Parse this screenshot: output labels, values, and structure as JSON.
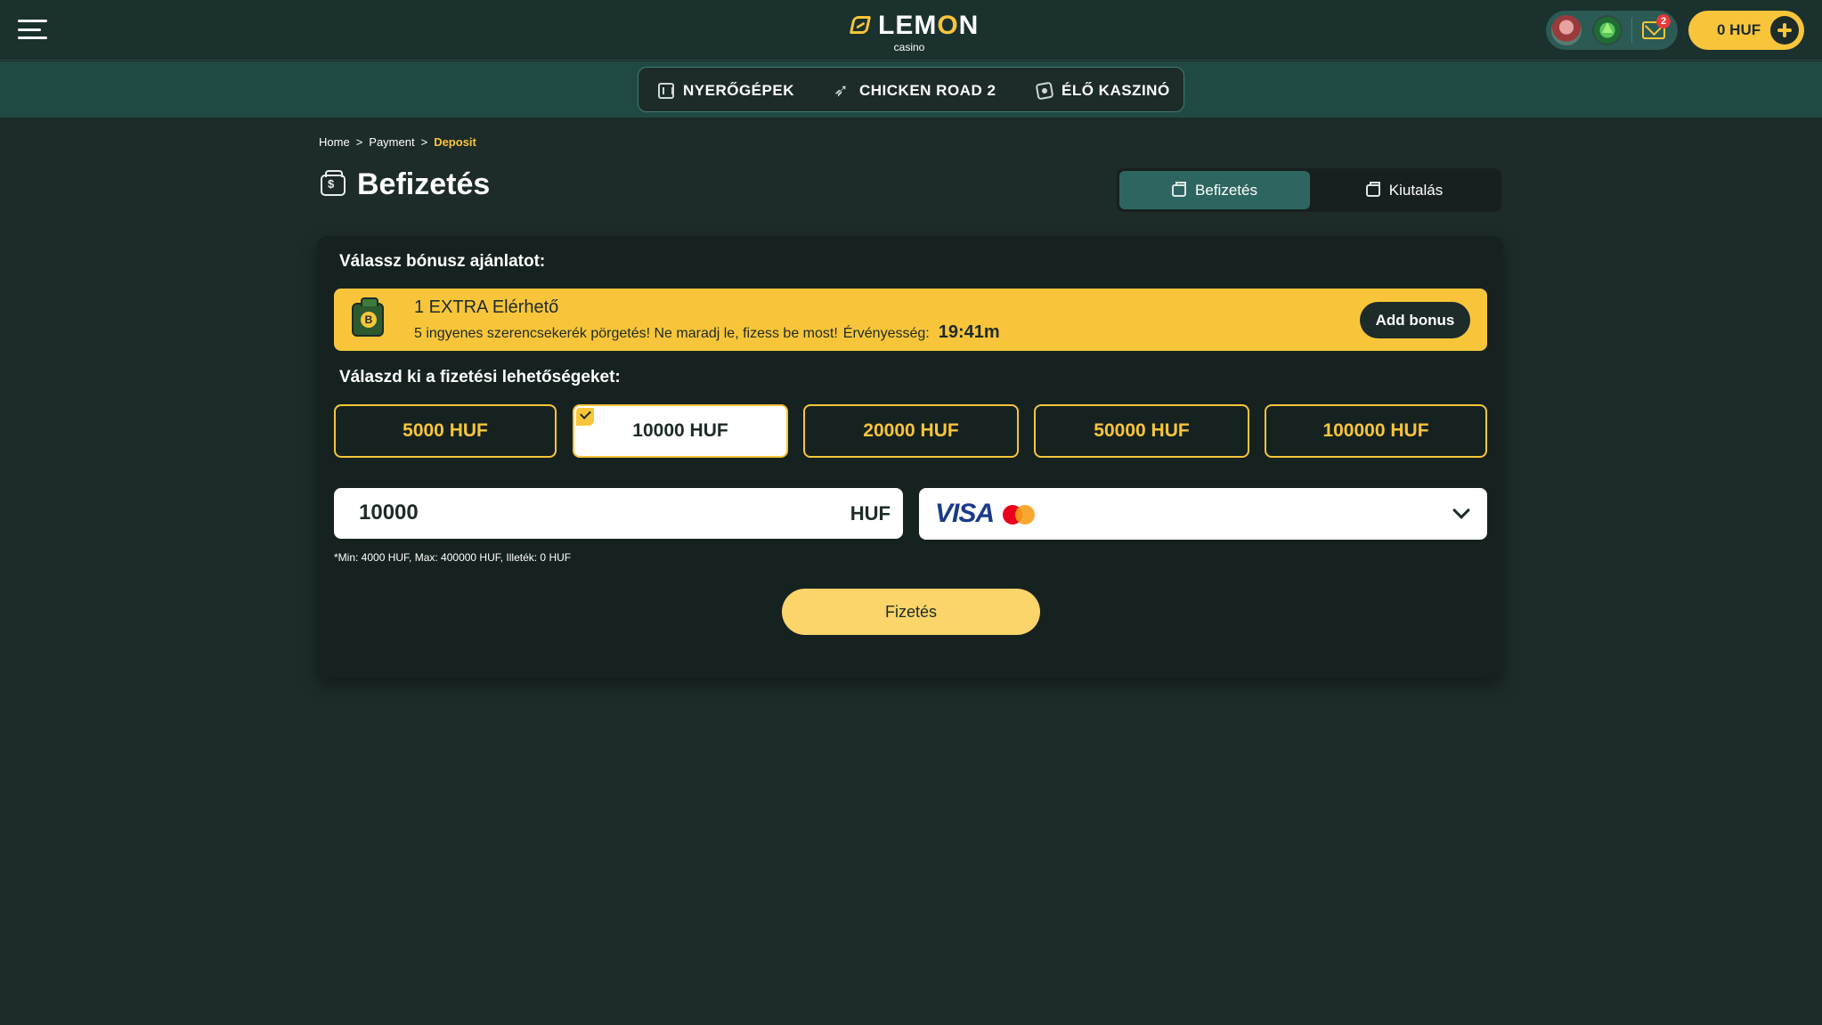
{
  "header": {
    "logo_text_left": "LEM",
    "logo_text_accent": "O",
    "logo_text_right": "N",
    "logo_sub": "casino",
    "mail_badge": "2",
    "balance": "0 HUF"
  },
  "nav": {
    "items": [
      {
        "label": "NYERŐGÉPEK",
        "icon": "slots-icon"
      },
      {
        "label": "CHICKEN ROAD 2",
        "icon": "chicken-icon"
      },
      {
        "label": "ÉLŐ KASZINÓ",
        "icon": "live-casino-icon"
      }
    ]
  },
  "breadcrumb": {
    "home": "Home",
    "payment": "Payment",
    "current": "Deposit",
    "sep": ">"
  },
  "page": {
    "title": "Befizetés",
    "tabs": [
      {
        "label": "Befizetés",
        "active": true
      },
      {
        "label": "Kiutalás",
        "active": false
      }
    ]
  },
  "bonus": {
    "section_label": "Válassz bónusz ajánlatot:",
    "title": "1 EXTRA  Elérhető",
    "description": "5 ingyenes szerencsekerék pörgetés! Ne maradj le, fizess be most!",
    "validity_label": "Érvényesség:",
    "timer": "19:41m",
    "button": "Add bonus"
  },
  "payment": {
    "section_label": "Válaszd ki a fizetési lehetőségeket:",
    "amounts": [
      {
        "label": "5000 HUF",
        "selected": false
      },
      {
        "label": "10000 HUF",
        "selected": true
      },
      {
        "label": "20000 HUF",
        "selected": false
      },
      {
        "label": "50000 HUF",
        "selected": false
      },
      {
        "label": "100000 HUF",
        "selected": false
      }
    ],
    "amount_value": "10000",
    "currency": "HUF",
    "method": "VISA",
    "limits": "*Min: 4000 HUF, Max: 400000 HUF, Illeték: 0 HUF",
    "submit": "Fizetés"
  },
  "colors": {
    "background": "#1d2b29",
    "accent": "#f8c53a",
    "card": "#162220",
    "active_tab": "#2d6660"
  }
}
